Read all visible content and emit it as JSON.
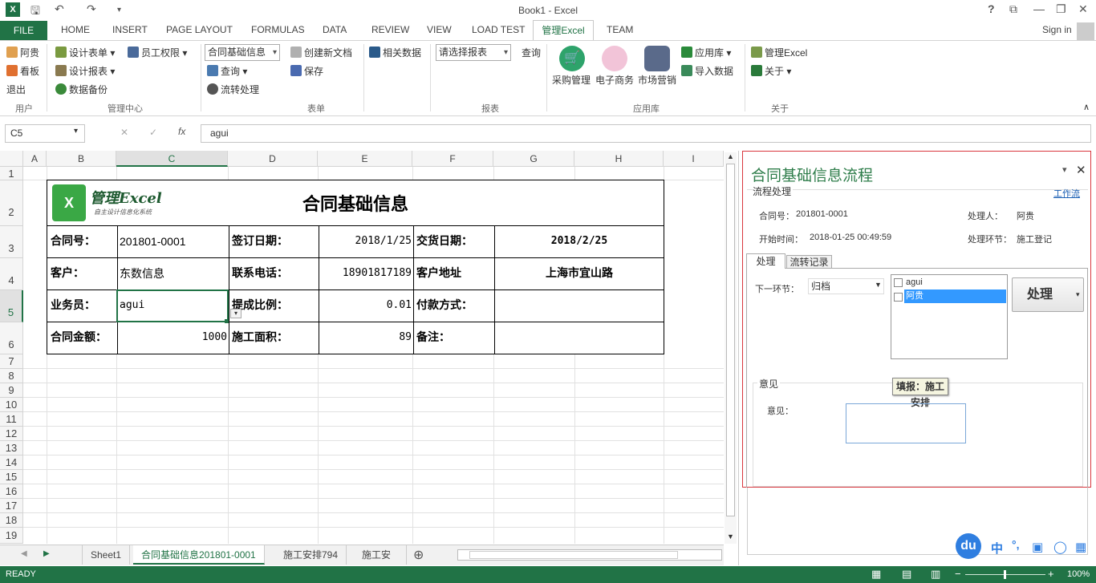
{
  "title": "Book1 - Excel",
  "tabs": [
    "HOME",
    "INSERT",
    "PAGE LAYOUT",
    "FORMULAS",
    "DATA",
    "REVIEW",
    "VIEW",
    "LOAD TEST",
    "TEAM"
  ],
  "file_tab": "FILE",
  "active_tab": "管理Excel",
  "sign_in": "Sign in",
  "ribbon": {
    "user_items": [
      "阿贵",
      "看板",
      "退出"
    ],
    "user_group": "用户",
    "mgmt_items": [
      "设计表单",
      "设计报表",
      "数据备份",
      "员工权限"
    ],
    "mgmt_group": "管理中心",
    "form_dropdown": "合同基础信息",
    "form_items": [
      "查询",
      "流转处理",
      "创建新文档",
      "保存",
      "相关数据"
    ],
    "form_group": "表单",
    "report_dropdown": "请选择报表",
    "report_query": "查询",
    "report_group": "报表",
    "apps": [
      "采购管理",
      "电子商务",
      "市场营销"
    ],
    "app_items": [
      "应用库",
      "导入数据"
    ],
    "app_group": "应用库",
    "about_items": [
      "管理Excel",
      "关于"
    ],
    "about_group": "关于"
  },
  "formula": {
    "cell_ref": "C5",
    "value": "agui"
  },
  "columns": [
    "A",
    "B",
    "C",
    "D",
    "E",
    "F",
    "G",
    "H",
    "I"
  ],
  "rows": [
    "1",
    "2",
    "3",
    "4",
    "5",
    "6",
    "7",
    "8",
    "9",
    "10",
    "11",
    "12",
    "13",
    "14",
    "15",
    "16",
    "17",
    "18",
    "19"
  ],
  "form": {
    "logo_text": "管理Excel",
    "logo_sub": "自主设计信息化系统",
    "title": "合同基础信息",
    "r3": [
      "合同号：",
      "201801-0001",
      "签订日期：",
      "2018/1/25",
      "交货日期：",
      "2018/2/25"
    ],
    "r4": [
      "客户：",
      "东数信息",
      "联系电话：",
      "18901817189",
      "客户地址",
      "上海市宜山路"
    ],
    "r5": [
      "业务员：",
      "agui",
      "提成比例：",
      "0.01",
      "付款方式：",
      ""
    ],
    "r6": [
      "合同金额：",
      "1000",
      "施工面积：",
      "89",
      "备注：",
      ""
    ]
  },
  "sheets": [
    "Sheet1",
    "合同基础信息201801-0001",
    "施工安排794",
    "施工安"
  ],
  "status": {
    "ready": "READY",
    "zoom": "100%"
  },
  "panel": {
    "title": "合同基础信息流程",
    "section": "流程处理",
    "link": "工作流",
    "contract_label": "合同号：",
    "contract": "201801-0001",
    "handler_label": "处理人：",
    "handler": "阿贵",
    "start_label": "开始时间：",
    "start": "2018-01-25 00:49:59",
    "step_label": "处理环节：",
    "step": "施工登记",
    "tab1": "处理",
    "tab2": "流转记录",
    "next_label": "下一环节：",
    "next": "归档",
    "users": [
      "agui",
      "阿贵"
    ],
    "process_btn": "处理",
    "opinion_group": "意见",
    "opinion_label": "意见：",
    "tooltip": "填报：施工安排"
  },
  "ime": {
    "logo": "du",
    "items": [
      "中",
      "°,"
    ]
  },
  "colors": {
    "excel_green": "#217346",
    "border_red": "#d9363e"
  }
}
